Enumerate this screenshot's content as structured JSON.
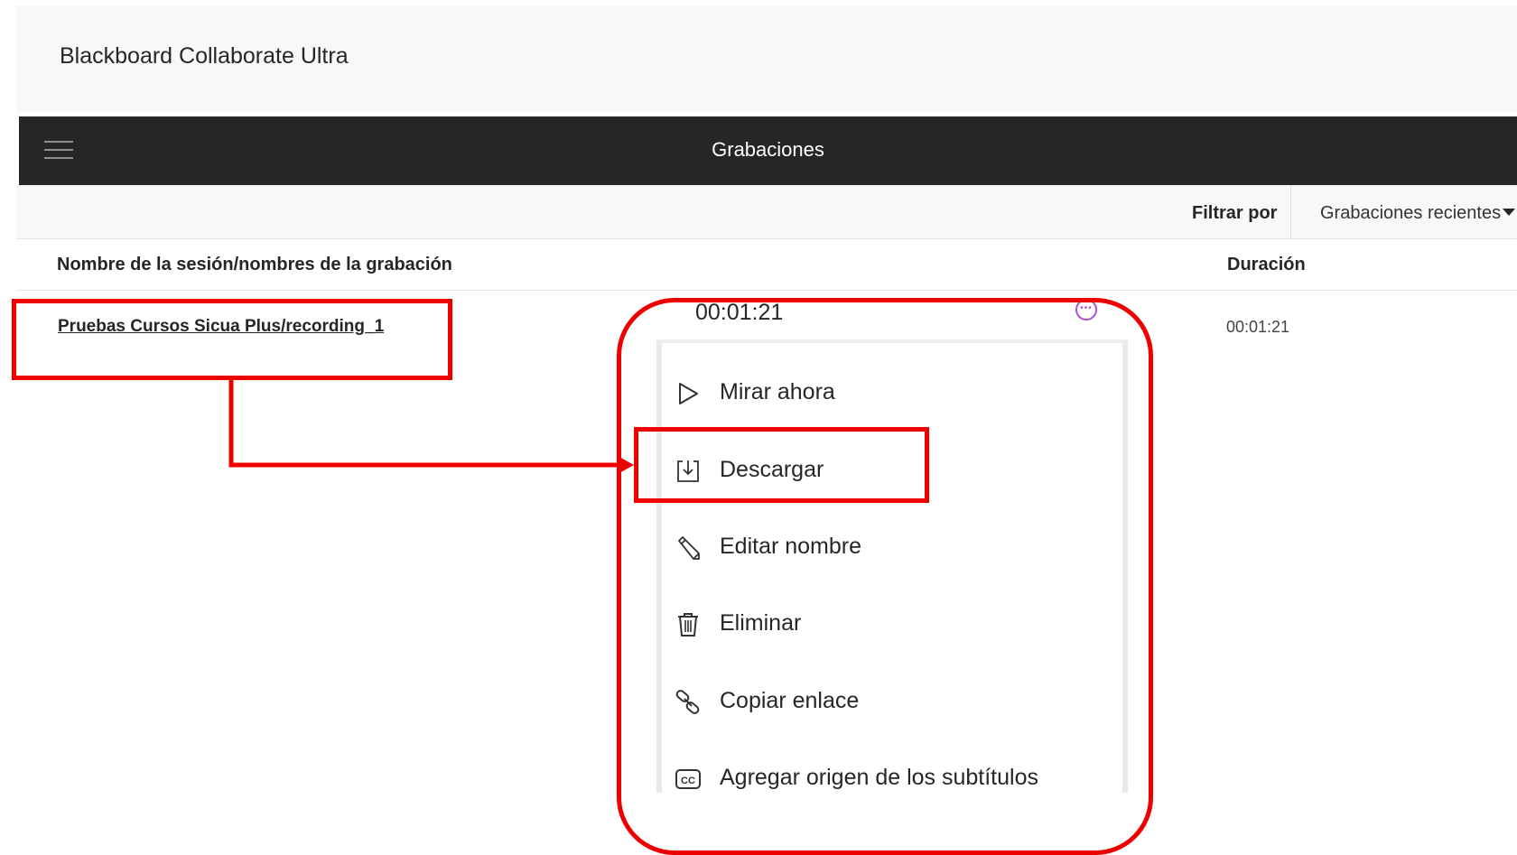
{
  "app": {
    "title": "Blackboard Collaborate Ultra"
  },
  "header": {
    "title": "Grabaciones",
    "menu_icon": "hamburger-menu-icon"
  },
  "filter": {
    "label": "Filtrar por",
    "selected": "Grabaciones recientes"
  },
  "table": {
    "columns": [
      "Nombre de la sesión/nombres de la grabación",
      "Duración"
    ],
    "rows": [
      {
        "name": "Pruebas Cursos Sicua Plus/recording_1",
        "duration": "00:01:21"
      }
    ]
  },
  "context_menu": {
    "duration": "00:01:21",
    "more_icon": "more-options-icon",
    "items": [
      {
        "label": "Mirar ahora",
        "icon": "play-icon"
      },
      {
        "label": "Descargar",
        "icon": "download-icon"
      },
      {
        "label": "Editar nombre",
        "icon": "pencil-icon"
      },
      {
        "label": "Eliminar",
        "icon": "trash-icon"
      },
      {
        "label": "Copiar enlace",
        "icon": "link-icon"
      },
      {
        "label": "Agregar origen de los subtítulos",
        "icon": "closed-captions-icon"
      }
    ]
  },
  "annotation": {
    "color": "#ee0000"
  }
}
